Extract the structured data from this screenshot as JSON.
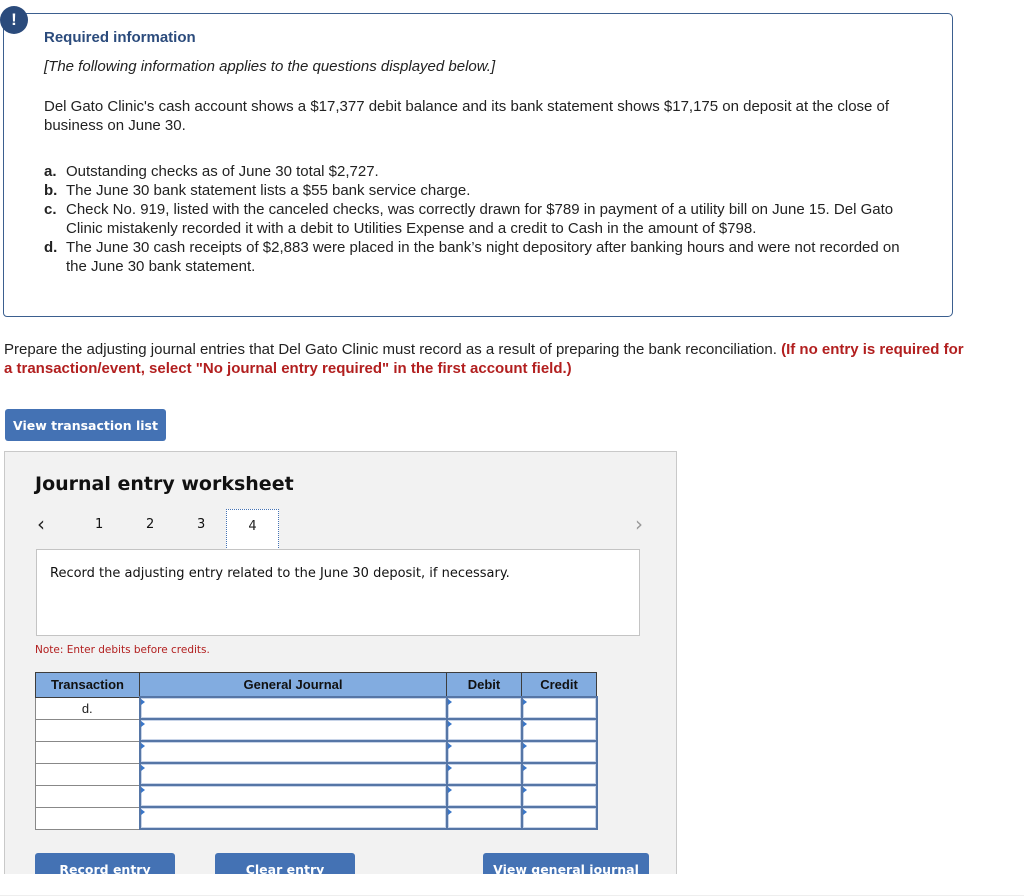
{
  "info": {
    "badge_icon": "!",
    "title": "Required information",
    "italic_note": "[The following information applies to the questions displayed below.]",
    "paragraph": "Del Gato Clinic's cash account shows a $17,377 debit balance and its bank statement shows $17,175 on deposit at the close of business on June 30.",
    "items": [
      {
        "letter": "a.",
        "text": "Outstanding checks as of June 30 total $2,727."
      },
      {
        "letter": "b.",
        "text": "The June 30 bank statement lists a $55 bank service charge."
      },
      {
        "letter": "c.",
        "text": "Check No. 919, listed with the canceled checks, was correctly drawn for $789 in payment of a utility bill on June 15. Del Gato Clinic mistakenly recorded it with a debit to Utilities Expense and a credit to Cash in the amount of $798."
      },
      {
        "letter": "d.",
        "text": "The June 30 cash receipts of $2,883 were placed in the bank’s night depository after banking hours and were not recorded on the June 30 bank statement."
      }
    ]
  },
  "prompt": {
    "text": "Prepare the adjusting journal entries that Del Gato Clinic must record as a result of preparing the bank reconciliation. ",
    "instruction": "(If no entry is required for a transaction/event, select \"No journal entry required\" in the first account field.)"
  },
  "buttons": {
    "view_transaction_list": "View transaction list",
    "record_entry": "Record entry",
    "clear_entry": "Clear entry",
    "view_general_journal": "View general journal"
  },
  "worksheet": {
    "title": "Journal entry worksheet",
    "prev_icon": "‹",
    "next_icon": "›",
    "tabs": [
      "1",
      "2",
      "3",
      "4"
    ],
    "active_tab": "4",
    "description": "Record the adjusting entry related to the June 30 deposit, if necessary.",
    "note": "Note: Enter debits before credits.",
    "table": {
      "headers": [
        "Transaction",
        "General Journal",
        "Debit",
        "Credit"
      ],
      "rows": [
        {
          "transaction": "d.",
          "account": "",
          "debit": "",
          "credit": ""
        },
        {
          "transaction": "",
          "account": "",
          "debit": "",
          "credit": ""
        },
        {
          "transaction": "",
          "account": "",
          "debit": "",
          "credit": ""
        },
        {
          "transaction": "",
          "account": "",
          "debit": "",
          "credit": ""
        },
        {
          "transaction": "",
          "account": "",
          "debit": "",
          "credit": ""
        },
        {
          "transaction": "",
          "account": "",
          "debit": "",
          "credit": ""
        }
      ]
    }
  }
}
